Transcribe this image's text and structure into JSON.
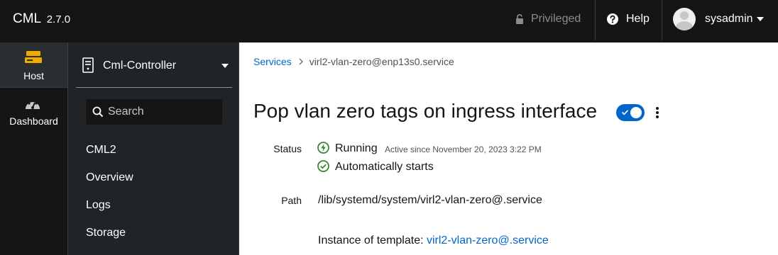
{
  "header": {
    "brand": "CML",
    "version": "2.7.0",
    "privileged_label": "Privileged",
    "help_label": "Help",
    "user_name": "sysadmin"
  },
  "rail": {
    "items": [
      {
        "label": "Host",
        "icon": "server-stack-icon"
      },
      {
        "label": "Dashboard",
        "icon": "dashboard-gauge-icon"
      }
    ]
  },
  "sidebar": {
    "host_selector": "Cml-Controller",
    "search_placeholder": "Search",
    "items": [
      {
        "label": "CML2"
      },
      {
        "label": "Overview"
      },
      {
        "label": "Logs"
      },
      {
        "label": "Storage"
      }
    ]
  },
  "main": {
    "breadcrumb": {
      "parent": "Services",
      "current": "virl2-vlan-zero@enp13s0.service"
    },
    "title": "Pop vlan zero tags on ingress interface",
    "toggle_on": true,
    "status": {
      "label": "Status",
      "running": "Running",
      "since": "Active since November 20, 2023 3:22 PM",
      "autostart": "Automatically starts"
    },
    "path": {
      "label": "Path",
      "value": "/lib/systemd/system/virl2-vlan-zero@.service",
      "instance_prefix": "Instance of template:",
      "instance_link": "virl2-vlan-zero@.service"
    }
  },
  "colors": {
    "header_bg": "#151515",
    "sidebar_bg": "#212427",
    "accent": "#0066cc",
    "host_icon": "#f0ab00",
    "status_ok": "#3e8635"
  }
}
